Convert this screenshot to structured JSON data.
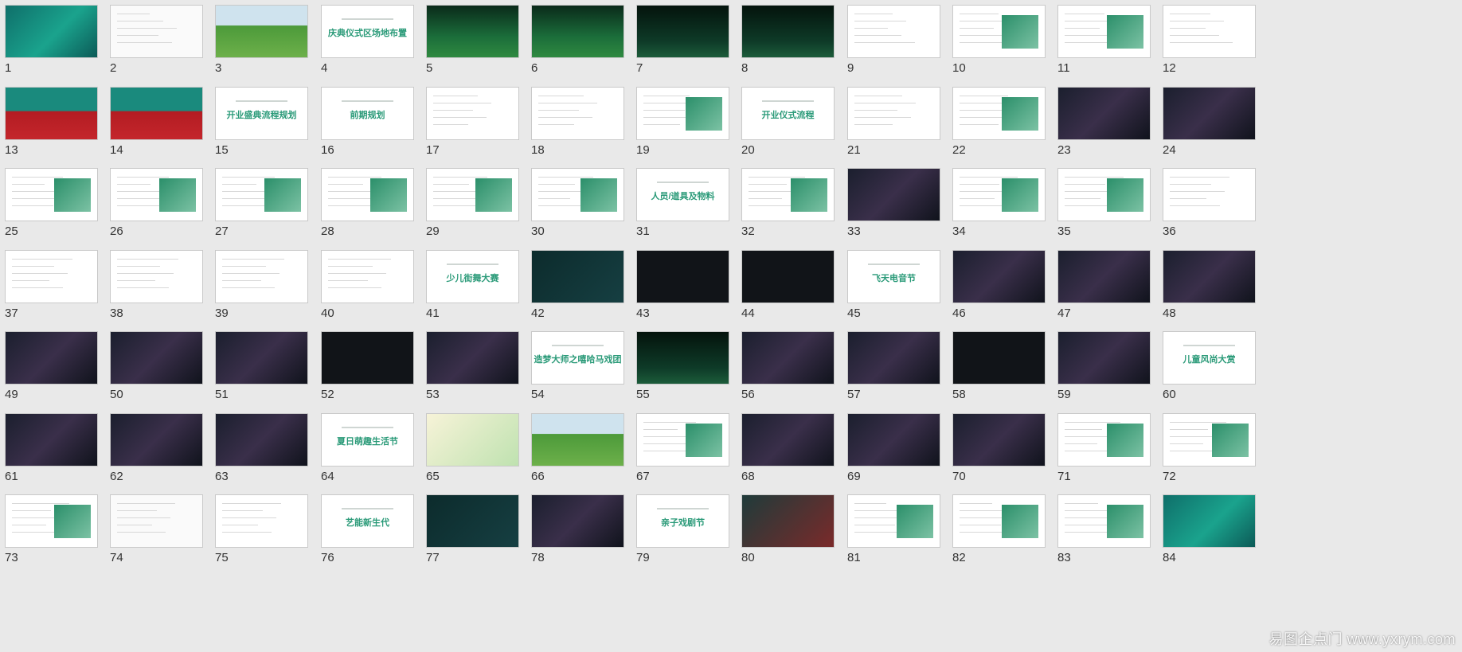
{
  "slides": [
    {
      "n": "1",
      "kind": "hero"
    },
    {
      "n": "2",
      "kind": "map"
    },
    {
      "n": "3",
      "kind": "field"
    },
    {
      "n": "4",
      "kind": "title",
      "title": "庆典仪式区场地布置"
    },
    {
      "n": "5",
      "kind": "stage-green"
    },
    {
      "n": "6",
      "kind": "stage-green"
    },
    {
      "n": "7",
      "kind": "stage-dark"
    },
    {
      "n": "8",
      "kind": "stage-dark"
    },
    {
      "n": "9",
      "kind": "blueprint"
    },
    {
      "n": "10",
      "kind": "text-image"
    },
    {
      "n": "11",
      "kind": "text-image"
    },
    {
      "n": "12",
      "kind": "table"
    },
    {
      "n": "13",
      "kind": "hero-red"
    },
    {
      "n": "14",
      "kind": "hero-red"
    },
    {
      "n": "15",
      "kind": "title",
      "title": "开业盛典流程规划"
    },
    {
      "n": "16",
      "kind": "title",
      "title": "前期规划"
    },
    {
      "n": "17",
      "kind": "text"
    },
    {
      "n": "18",
      "kind": "flow"
    },
    {
      "n": "19",
      "kind": "costume"
    },
    {
      "n": "20",
      "kind": "title",
      "title": "开业仪式流程"
    },
    {
      "n": "21",
      "kind": "table"
    },
    {
      "n": "22",
      "kind": "text-image"
    },
    {
      "n": "23",
      "kind": "photos-dark"
    },
    {
      "n": "24",
      "kind": "photos-dark"
    },
    {
      "n": "25",
      "kind": "photos"
    },
    {
      "n": "26",
      "kind": "photos"
    },
    {
      "n": "27",
      "kind": "photos"
    },
    {
      "n": "28",
      "kind": "photos"
    },
    {
      "n": "29",
      "kind": "photos"
    },
    {
      "n": "30",
      "kind": "photos"
    },
    {
      "n": "31",
      "kind": "title",
      "title": "人员/道具及物料"
    },
    {
      "n": "32",
      "kind": "costume"
    },
    {
      "n": "33",
      "kind": "photos-dark"
    },
    {
      "n": "34",
      "kind": "photos"
    },
    {
      "n": "35",
      "kind": "photos"
    },
    {
      "n": "36",
      "kind": "table"
    },
    {
      "n": "37",
      "kind": "table"
    },
    {
      "n": "38",
      "kind": "table"
    },
    {
      "n": "39",
      "kind": "table"
    },
    {
      "n": "40",
      "kind": "table"
    },
    {
      "n": "41",
      "kind": "title",
      "title": "少儿街舞大赛"
    },
    {
      "n": "42",
      "kind": "dark-teal"
    },
    {
      "n": "43",
      "kind": "dark"
    },
    {
      "n": "44",
      "kind": "dark"
    },
    {
      "n": "45",
      "kind": "title",
      "title": "飞天电音节"
    },
    {
      "n": "46",
      "kind": "photos-dark"
    },
    {
      "n": "47",
      "kind": "photos-dark"
    },
    {
      "n": "48",
      "kind": "photos-dark"
    },
    {
      "n": "49",
      "kind": "photos-dark"
    },
    {
      "n": "50",
      "kind": "photos-dark"
    },
    {
      "n": "51",
      "kind": "photos-dark"
    },
    {
      "n": "52",
      "kind": "dark"
    },
    {
      "n": "53",
      "kind": "photos-dark"
    },
    {
      "n": "54",
      "kind": "title",
      "title": "造梦大师之嘻哈马戏团"
    },
    {
      "n": "55",
      "kind": "stage-dark"
    },
    {
      "n": "56",
      "kind": "photos-dark"
    },
    {
      "n": "57",
      "kind": "photos-dark"
    },
    {
      "n": "58",
      "kind": "dark"
    },
    {
      "n": "59",
      "kind": "photos-dark"
    },
    {
      "n": "60",
      "kind": "title",
      "title": "儿童风尚大赏"
    },
    {
      "n": "61",
      "kind": "photos-dark"
    },
    {
      "n": "62",
      "kind": "photos-dark"
    },
    {
      "n": "63",
      "kind": "photos-dark"
    },
    {
      "n": "64",
      "kind": "title",
      "title": "夏日萌趣生活节"
    },
    {
      "n": "65",
      "kind": "poster"
    },
    {
      "n": "66",
      "kind": "field"
    },
    {
      "n": "67",
      "kind": "text-image"
    },
    {
      "n": "68",
      "kind": "photos-dark"
    },
    {
      "n": "69",
      "kind": "photos-dark"
    },
    {
      "n": "70",
      "kind": "photos-dark"
    },
    {
      "n": "71",
      "kind": "photos"
    },
    {
      "n": "72",
      "kind": "photos"
    },
    {
      "n": "73",
      "kind": "photos"
    },
    {
      "n": "74",
      "kind": "map"
    },
    {
      "n": "75",
      "kind": "text"
    },
    {
      "n": "76",
      "kind": "title",
      "title": "艺能新生代"
    },
    {
      "n": "77",
      "kind": "dark-teal"
    },
    {
      "n": "78",
      "kind": "photos-dark"
    },
    {
      "n": "79",
      "kind": "title",
      "title": "亲子戏剧节"
    },
    {
      "n": "80",
      "kind": "poster-dark"
    },
    {
      "n": "81",
      "kind": "text-image"
    },
    {
      "n": "82",
      "kind": "text-image"
    },
    {
      "n": "83",
      "kind": "text-image"
    },
    {
      "n": "84",
      "kind": "hero"
    }
  ],
  "watermark": "易图企点门 www.yxrym.com",
  "colors": {
    "background": "#e9e9e9",
    "accent": "#2a9a78",
    "number": "#333333"
  }
}
